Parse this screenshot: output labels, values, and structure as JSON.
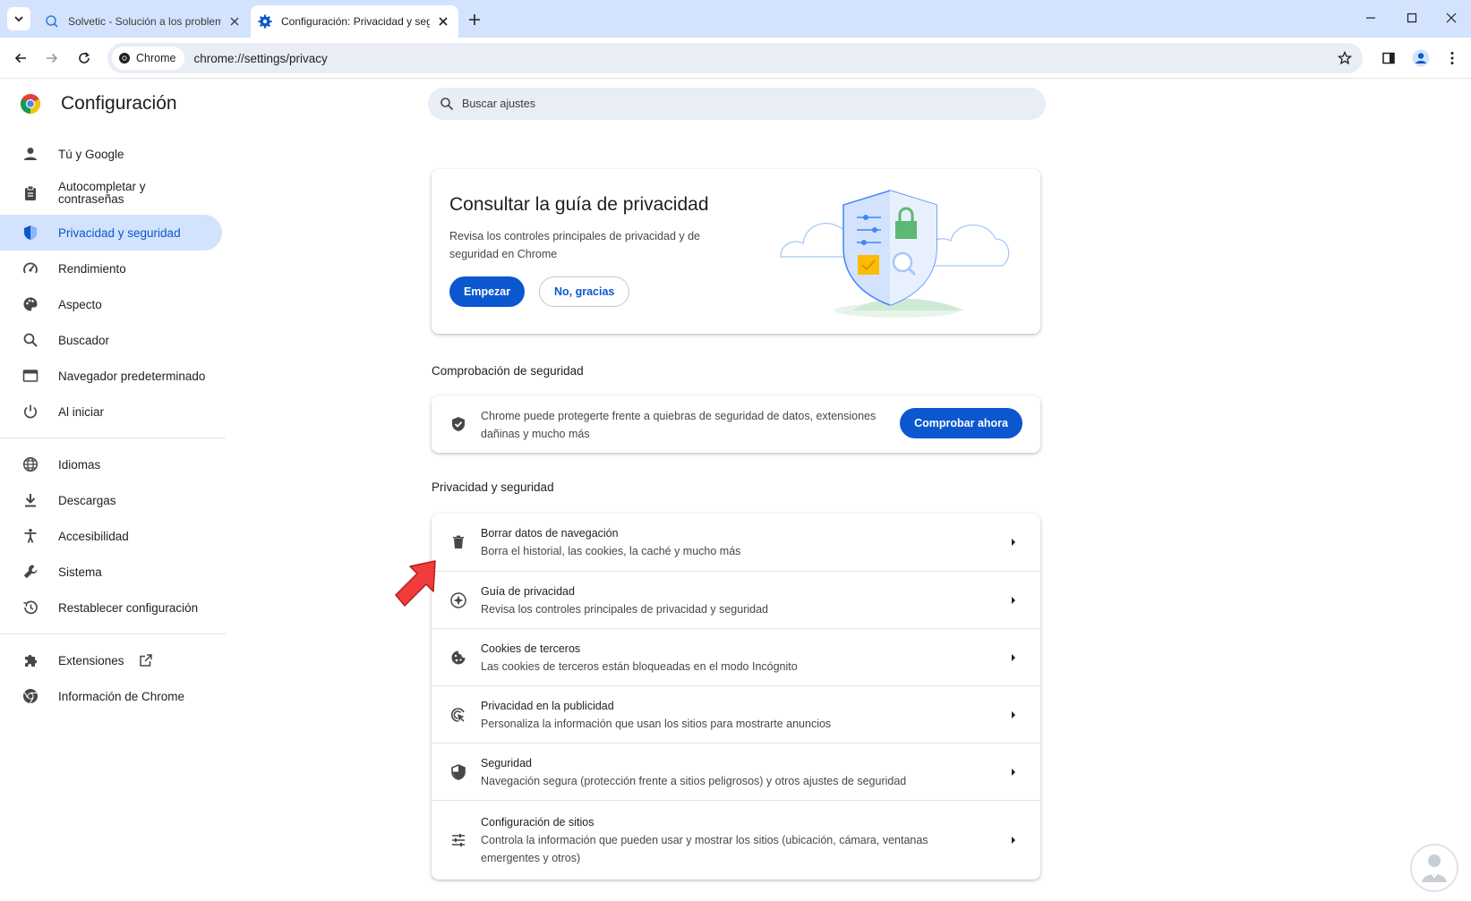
{
  "browser": {
    "tabs": [
      {
        "title": "Solvetic - Solución a los problem",
        "active": false
      },
      {
        "title": "Configuración: Privacidad y seg",
        "active": true
      }
    ],
    "chip_label": "Chrome",
    "url": "chrome://settings/privacy"
  },
  "settings": {
    "brand": "Configuración",
    "nav": [
      {
        "label": "Tú y Google",
        "icon": "person-icon"
      },
      {
        "label": "Autocompletar y contraseñas",
        "icon": "clipboard-icon"
      },
      {
        "label": "Privacidad y seguridad",
        "icon": "shield-icon",
        "active": true
      },
      {
        "label": "Rendimiento",
        "icon": "speedometer-icon"
      },
      {
        "label": "Aspecto",
        "icon": "palette-icon"
      },
      {
        "label": "Buscador",
        "icon": "search-icon"
      },
      {
        "label": "Navegador predeterminado",
        "icon": "browser-window-icon"
      },
      {
        "label": "Al iniciar",
        "icon": "power-icon"
      },
      {
        "label": "Idiomas",
        "icon": "globe-icon"
      },
      {
        "label": "Descargas",
        "icon": "download-icon"
      },
      {
        "label": "Accesibilidad",
        "icon": "accessibility-icon"
      },
      {
        "label": "Sistema",
        "icon": "wrench-icon"
      },
      {
        "label": "Restablecer configuración",
        "icon": "history-icon"
      },
      {
        "label": "Extensiones",
        "icon": "puzzle-icon"
      },
      {
        "label": "Información de Chrome",
        "icon": "chrome-icon"
      }
    ],
    "search_placeholder": "Buscar ajustes"
  },
  "guide_card": {
    "title": "Consultar la guía de privacidad",
    "desc": "Revisa los controles principales de privacidad y de seguridad en Chrome",
    "start_label": "Empezar",
    "dismiss_label": "No, gracias"
  },
  "safety_check": {
    "section_title": "Comprobación de seguridad",
    "text": "Chrome puede protegerte frente a quiebras de seguridad de datos, extensiones dañinas y mucho más",
    "button_label": "Comprobar ahora"
  },
  "privacy": {
    "section_title": "Privacidad y seguridad",
    "rows": [
      {
        "title": "Borrar datos de navegación",
        "desc": "Borra el historial, las cookies, la caché y mucho más",
        "icon": "trash-icon"
      },
      {
        "title": "Guía de privacidad",
        "desc": "Revisa los controles principales de privacidad y seguridad",
        "icon": "compass-icon"
      },
      {
        "title": "Cookies de terceros",
        "desc": "Las cookies de terceros están bloqueadas en el modo Incógnito",
        "icon": "cookie-icon"
      },
      {
        "title": "Privacidad en la publicidad",
        "desc": "Personaliza la información que usan los sitios para mostrarte anuncios",
        "icon": "ad-privacy-icon"
      },
      {
        "title": "Seguridad",
        "desc": "Navegación segura (protección frente a sitios peligrosos) y otros ajustes de seguridad",
        "icon": "security-shield-icon"
      },
      {
        "title": "Configuración de sitios",
        "desc": "Controla la información que pueden usar y mostrar los sitios (ubicación, cámara, ventanas emergentes y otros)",
        "icon": "tune-icon"
      }
    ]
  },
  "colors": {
    "accent": "#0b57d0",
    "tabstrip": "#d3e3fd",
    "omnibox": "#e9eef6",
    "arrow": "#f03c3c"
  }
}
